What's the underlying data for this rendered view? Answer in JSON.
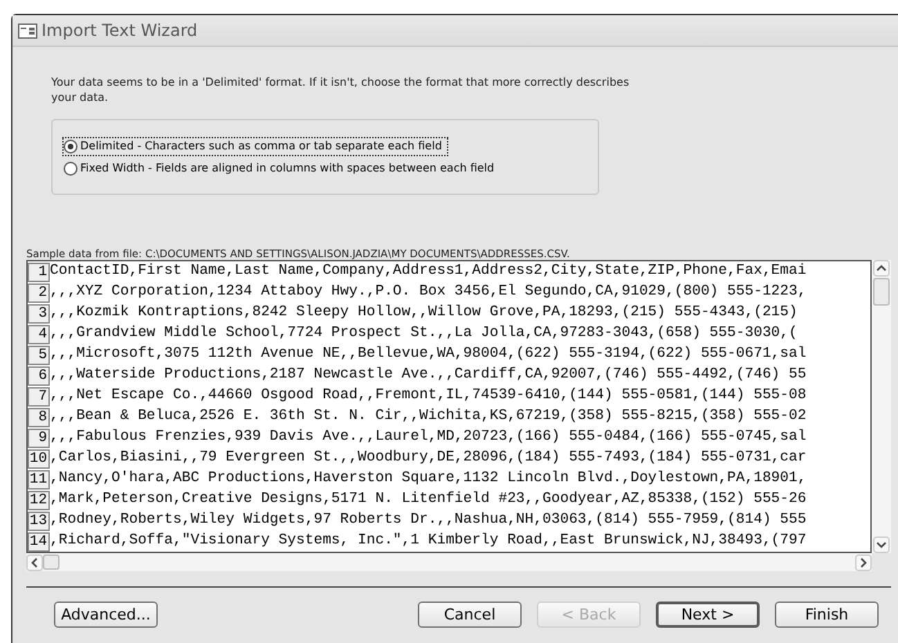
{
  "window": {
    "title": "Import Text Wizard"
  },
  "intro": "Your data seems to be in a 'Delimited' format. If it isn't, choose the format that more correctly describes your data.",
  "format_options": [
    {
      "label": "Delimited - Characters such as comma or tab separate each field",
      "selected": true
    },
    {
      "label": "Fixed Width - Fields are aligned in columns with spaces between each field",
      "selected": false
    }
  ],
  "sample_label": "Sample data from file: C:\\DOCUMENTS AND SETTINGS\\ALISON.JADZIA\\MY DOCUMENTS\\ADDRESSES.CSV.",
  "sample_rows": [
    {
      "number": "1",
      "text": "ContactID,First Name,Last Name,Company,Address1,Address2,City,State,ZIP,Phone,Fax,Emai"
    },
    {
      "number": "2",
      "text": ",,,XYZ Corporation,1234 Attaboy Hwy.,P.O. Box 3456,El Segundo,CA,91029,(800) 555-1223,"
    },
    {
      "number": "3",
      "text": ",,,Kozmik Kontraptions,8242 Sleepy Hollow,,Willow Grove,PA,18293,(215) 555-4343,(215)"
    },
    {
      "number": "4",
      "text": ",,,Grandview Middle School,7724 Prospect St.,,La Jolla,CA,97283-3043,(658) 555-3030,("
    },
    {
      "number": "5",
      "text": ",,,Microsoft,3075 112th Avenue NE,,Bellevue,WA,98004,(622) 555-3194,(622) 555-0671,sal"
    },
    {
      "number": "6",
      "text": ",,,Waterside Productions,2187 Newcastle Ave.,,Cardiff,CA,92007,(746) 555-4492,(746) 55"
    },
    {
      "number": "7",
      "text": ",,,Net Escape Co.,44660 Osgood Road,,Fremont,IL,74539-6410,(144) 555-0581,(144) 555-08"
    },
    {
      "number": "8",
      "text": ",,,Bean & Beluca,2526 E. 36th St. N. Cir,,Wichita,KS,67219,(358) 555-8215,(358) 555-02"
    },
    {
      "number": "9",
      "text": ",,,Fabulous Frenzies,939 Davis Ave.,,Laurel,MD,20723,(166) 555-0484,(166) 555-0745,sal"
    },
    {
      "number": "10",
      "text": ",Carlos,Biasini,,79 Evergreen St.,,Woodbury,DE,28096,(184) 555-7493,(184) 555-0731,car"
    },
    {
      "number": "11",
      "text": ",Nancy,O'hara,ABC Productions,Haverston Square,1132 Lincoln Blvd.,Doylestown,PA,18901,"
    },
    {
      "number": "12",
      "text": ",Mark,Peterson,Creative Designs,5171 N. Litenfield #23,,Goodyear,AZ,85338,(152) 555-26"
    },
    {
      "number": "13",
      "text": ",Rodney,Roberts,Wiley Widgets,97 Roberts Dr.,,Nashua,NH,03063,(814) 555-7959,(814) 555"
    },
    {
      "number": "14",
      "text": ",Richard,Soffa,\"Visionary Systems, Inc.\",1 Kimberly Road,,East Brunswick,NJ,38493,(797"
    }
  ],
  "buttons": [
    {
      "label": "Advanced...",
      "disabled": false,
      "default": false
    },
    {
      "label": "Cancel",
      "disabled": false,
      "default": false
    },
    {
      "label": "< Back",
      "disabled": true,
      "default": false
    },
    {
      "label": "Next >",
      "disabled": false,
      "default": true
    },
    {
      "label": "Finish",
      "disabled": false,
      "default": false
    }
  ]
}
